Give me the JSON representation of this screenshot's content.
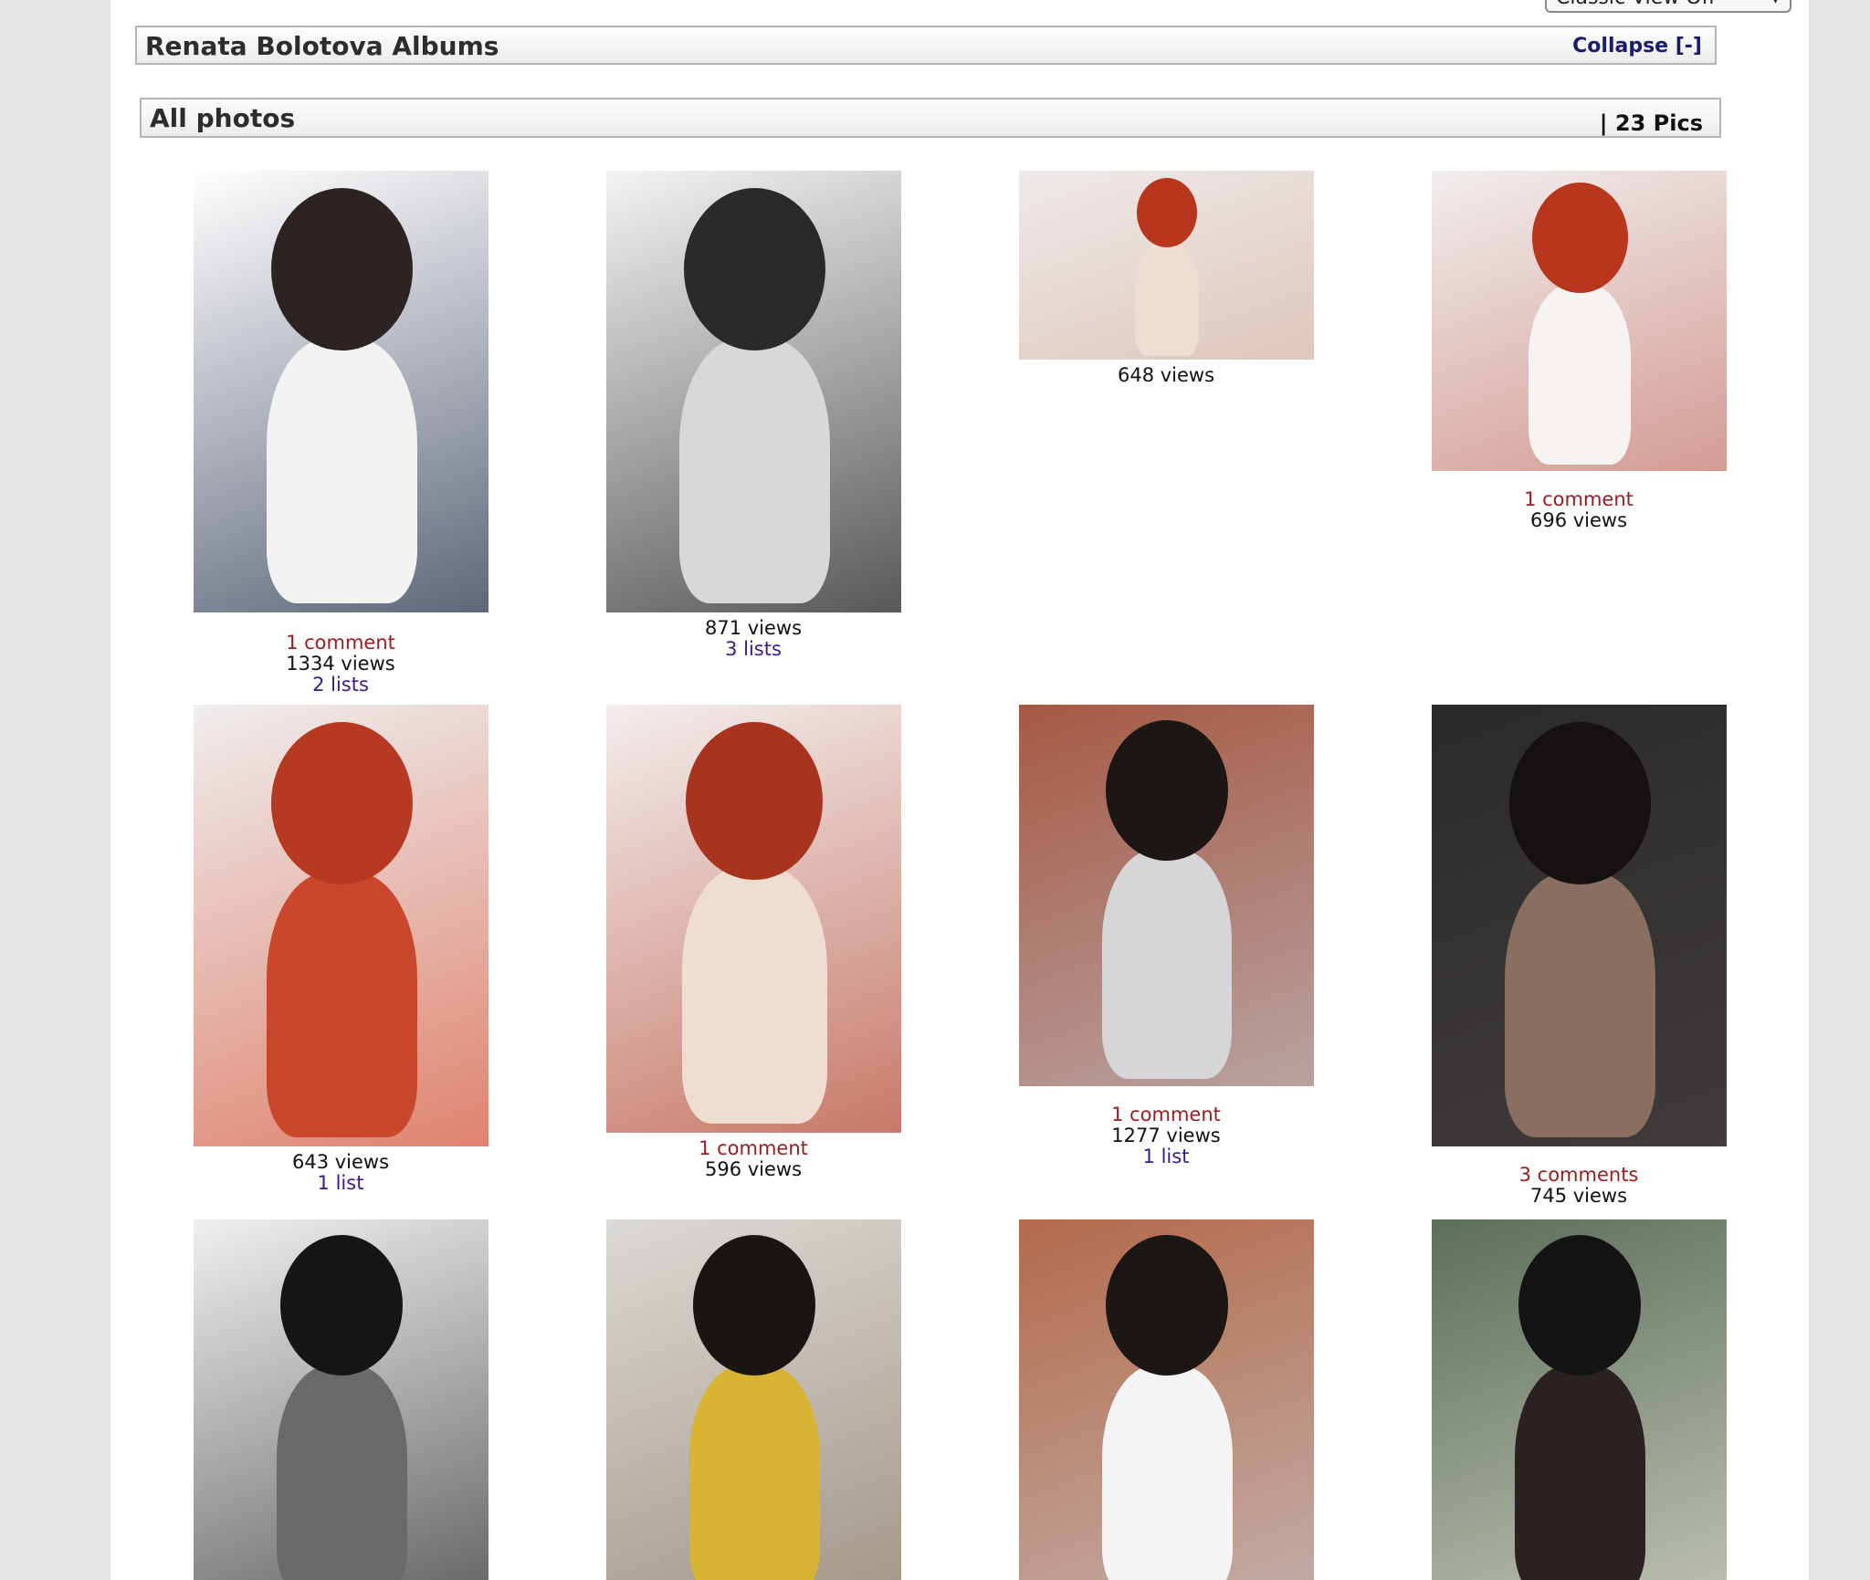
{
  "header": {
    "classic_view_label": "Classic View Off",
    "albums_title": "Renata Bolotova Albums",
    "collapse_label": "Collapse [-]",
    "album_title": "All photos",
    "pic_count": "| 23 Pics"
  },
  "photos": [
    {
      "comments": "1 comment",
      "views": "1334 views",
      "lists": "2 lists",
      "colors": [
        "#ffffff",
        "#2b2422",
        "#f2f2f2",
        "#1e2a44"
      ]
    },
    {
      "comments": "",
      "views": "871 views",
      "lists": "3 lists",
      "colors": [
        "#f4f4f4",
        "#2a2a2a",
        "#d8d8d8",
        "#1a1a1a"
      ]
    },
    {
      "comments": "",
      "views": "648 views",
      "lists": "",
      "colors": [
        "#eeeaea",
        "#b8361e",
        "#f0ddd2",
        "#d9b8a8"
      ]
    },
    {
      "comments": "1 comment",
      "views": "696 views",
      "lists": "",
      "colors": [
        "#f1eeee",
        "#b8361e",
        "#f6f3f1",
        "#c87a6e"
      ]
    },
    {
      "comments": "",
      "views": "643 views",
      "lists": "1 list",
      "colors": [
        "#efeeee",
        "#b63a22",
        "#c9482c",
        "#d8573a"
      ]
    },
    {
      "comments": "1 comment",
      "views": "596 views",
      "lists": "",
      "colors": [
        "#f4eeee",
        "#a8331e",
        "#f0ddd2",
        "#b44a32"
      ]
    },
    {
      "comments": "1 comment",
      "views": "1277 views",
      "lists": "1 list",
      "colors": [
        "#a65944",
        "#1c1614",
        "#d6d6d8",
        "#bfbfc4"
      ]
    },
    {
      "comments": "3 comments",
      "views": "745 views",
      "lists": "",
      "colors": [
        "#2a2a2a",
        "#141110",
        "#8a6f60",
        "#4a4242"
      ]
    },
    {
      "comments": "",
      "views": "",
      "lists": "",
      "colors": [
        "#f0f0f0",
        "#151515",
        "#6a6a6a",
        "#2c2c2c"
      ]
    },
    {
      "comments": "",
      "views": "",
      "lists": "",
      "colors": [
        "#dcdad6",
        "#1a1412",
        "#d9b433",
        "#8a7a66"
      ]
    },
    {
      "comments": "",
      "views": "",
      "lists": "",
      "colors": [
        "#b36a4a",
        "#1c1614",
        "#f4f4f4",
        "#c8c8cc"
      ]
    },
    {
      "comments": "",
      "views": "",
      "lists": "",
      "colors": [
        "#5d6e5a",
        "#141414",
        "#2a2220",
        "#e4e2d8"
      ]
    }
  ]
}
